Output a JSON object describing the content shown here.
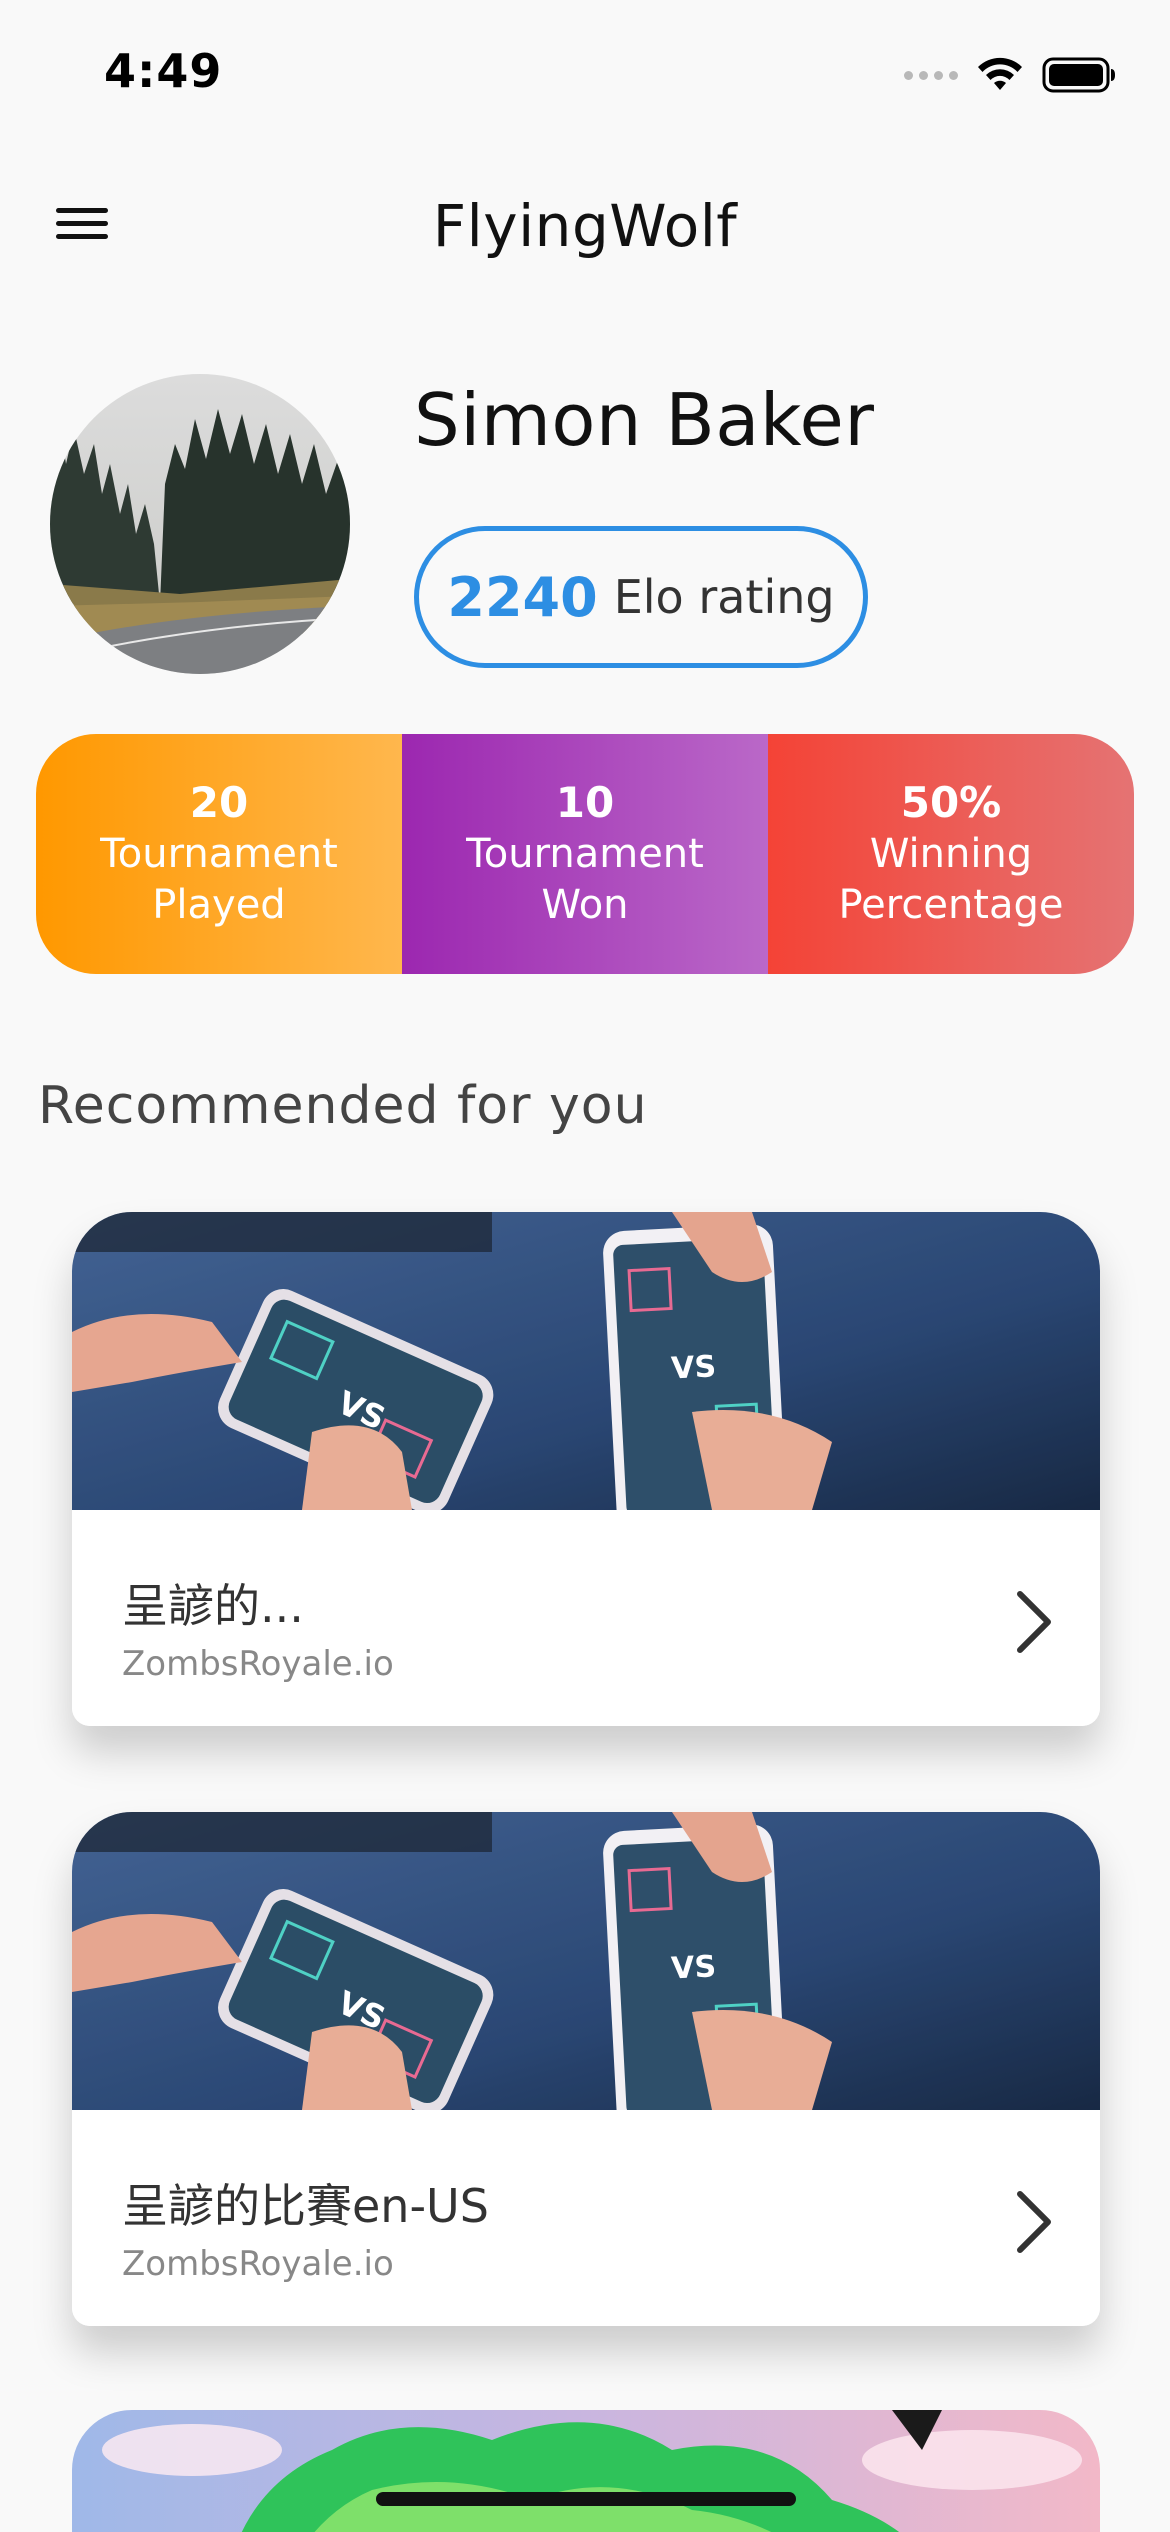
{
  "status_bar": {
    "time": "4:49",
    "icons": [
      "signal-dots-icon",
      "wifi-icon",
      "battery-icon"
    ]
  },
  "app_bar": {
    "title": "FlyingWolf",
    "menu_icon": "hamburger-menu-icon"
  },
  "profile": {
    "name": "Simon Baker",
    "elo_value": "2240",
    "elo_label": "Elo rating",
    "accent_color": "#2d8ee3"
  },
  "stats": [
    {
      "value": "20",
      "label_line1": "Tournament",
      "label_line2": "Played",
      "color": "#ff9800"
    },
    {
      "value": "10",
      "label_line1": "Tournament",
      "label_line2": "Won",
      "color": "#9c27b0"
    },
    {
      "value": "50%",
      "label_line1": "Winning",
      "label_line2": "Percentage",
      "color": "#f44336"
    }
  ],
  "section": {
    "title": "Recommended for you"
  },
  "cards": [
    {
      "title": "呈諺的...",
      "subtitle": "ZombsRoyale.io",
      "chevron_icon": "chevron-right-icon"
    },
    {
      "title": "呈諺的比賽en-US",
      "subtitle": "ZombsRoyale.io",
      "chevron_icon": "chevron-right-icon"
    }
  ]
}
